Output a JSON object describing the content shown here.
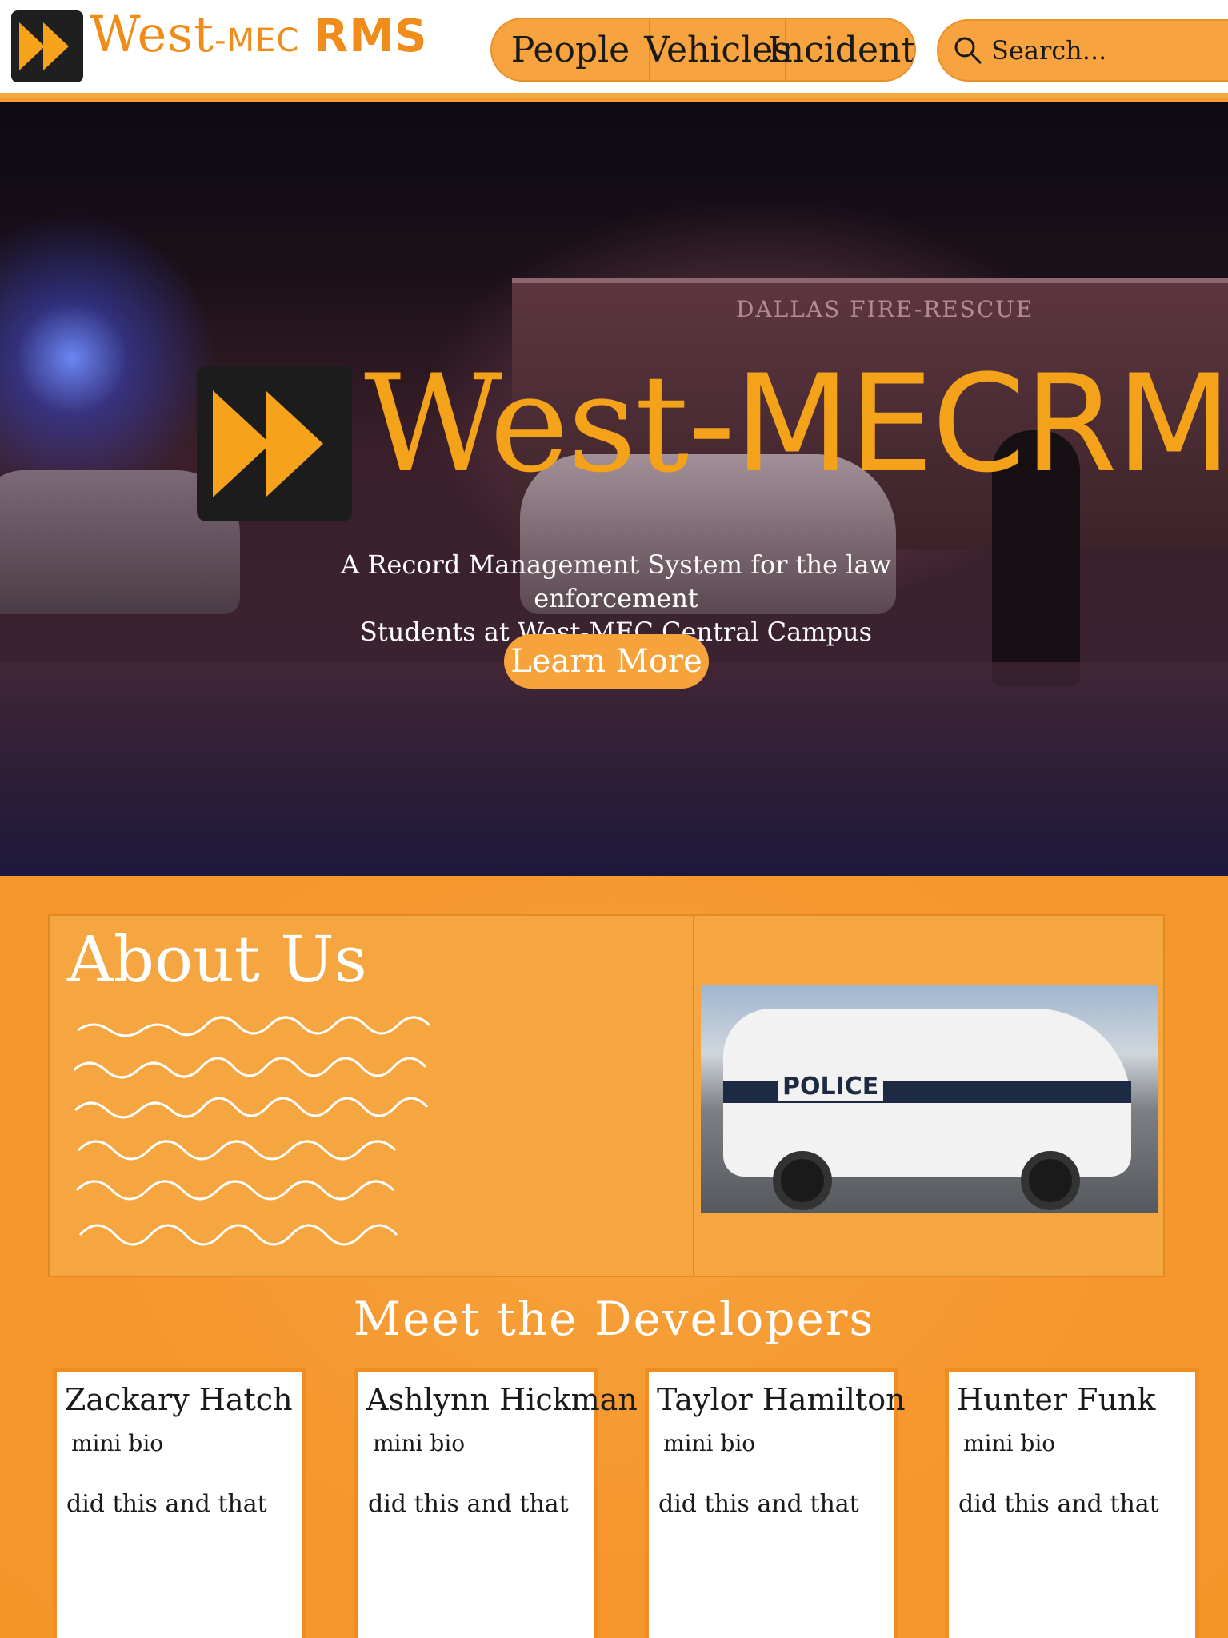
{
  "header": {
    "brand_main": "West",
    "brand_mec": "-MEC",
    "brand_rms": "RMS",
    "nav": [
      {
        "label": "People"
      },
      {
        "label": "Vehicles"
      },
      {
        "label": "Incidents"
      }
    ],
    "search_placeholder": "Search..."
  },
  "hero": {
    "title_west": "West",
    "title_mec": "-MEC",
    "title_rms": "RMS",
    "subtitle_line1": "A Record Management System for the law enforcement",
    "subtitle_line2": "Students at West-MEC Central Campus",
    "button_label": "Learn More",
    "truck_text": "DALLAS FIRE-RESCUE"
  },
  "about": {
    "title": "About Us",
    "photo_text": "POLICE"
  },
  "developers": {
    "title": "Meet the Developers",
    "cards": [
      {
        "name": "Zackary Hatch",
        "bio": "mini bio",
        "did": "did this and that"
      },
      {
        "name": "Ashlynn Hickman",
        "bio": "mini bio",
        "did": "did this and that"
      },
      {
        "name": "Taylor Hamilton",
        "bio": "mini bio",
        "did": "did this and that"
      },
      {
        "name": "Hunter Funk",
        "bio": "mini bio",
        "did": "did this and that"
      }
    ]
  },
  "colors": {
    "accent": "#f6a33c",
    "brand_text": "#f08c1a",
    "logo_bg": "#1f1f1f",
    "card_border": "#ef8d20"
  }
}
